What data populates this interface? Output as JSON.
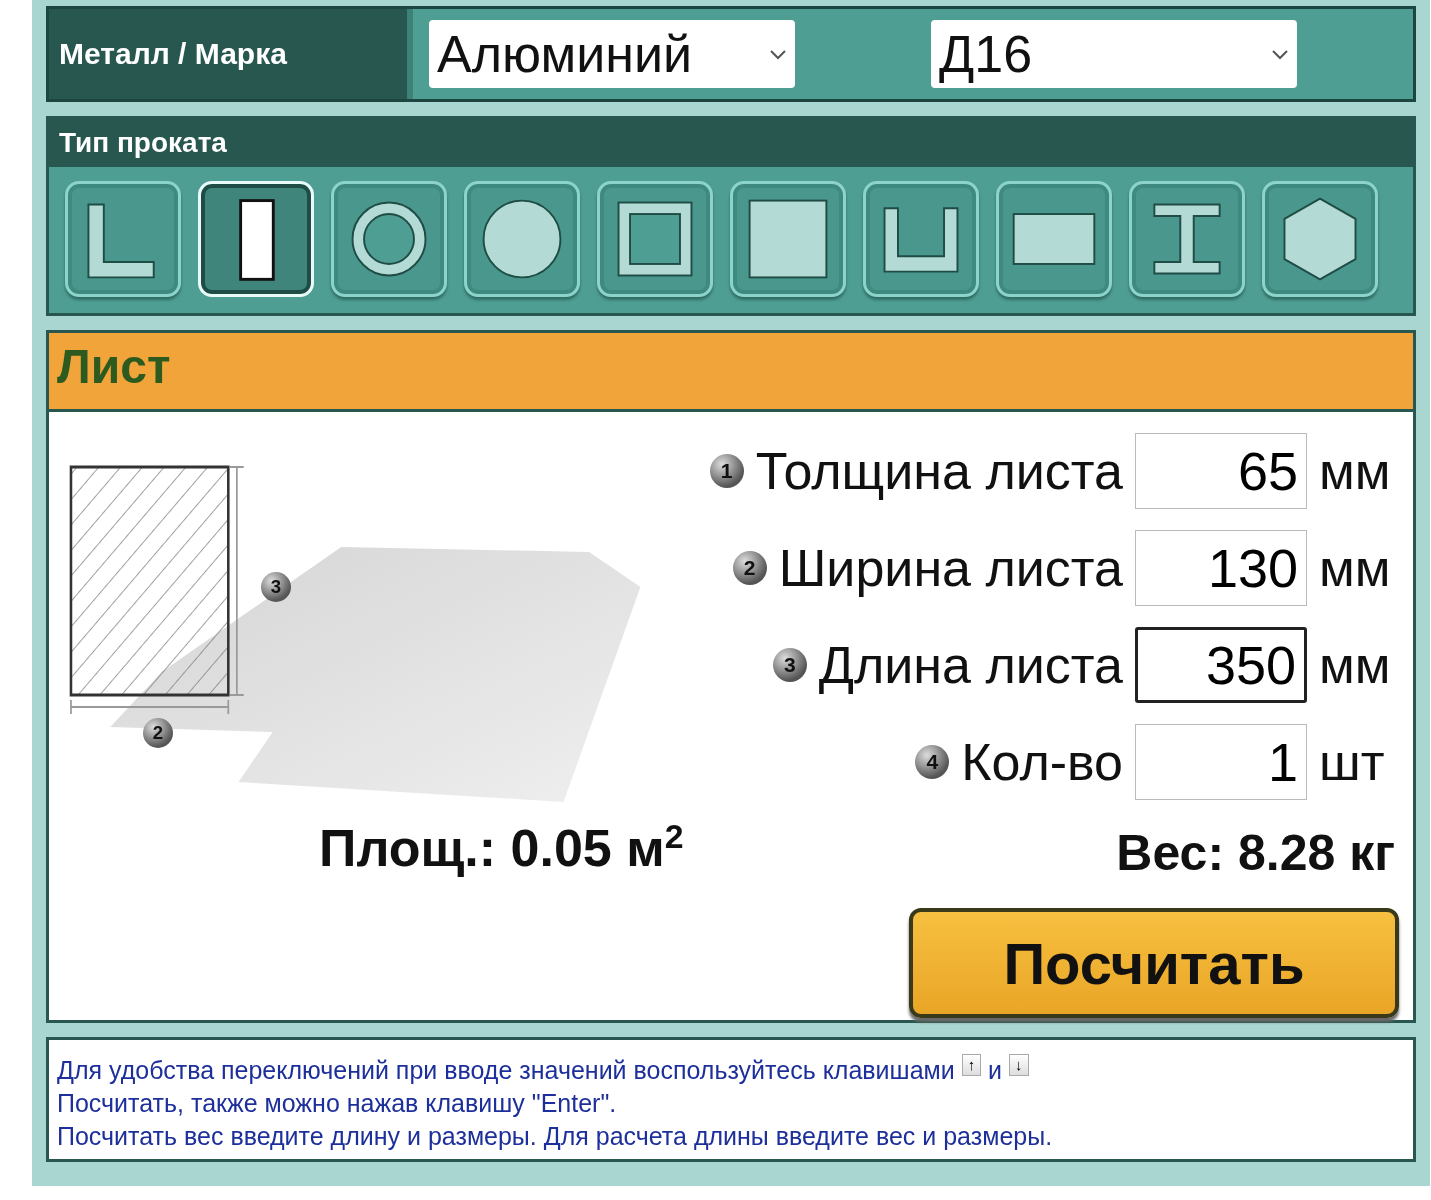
{
  "metal_bar": {
    "label": "Металл / Марка",
    "metal_select": {
      "value": "Алюминий"
    },
    "grade_select": {
      "value": "Д16"
    }
  },
  "profile_panel": {
    "title": "Тип проката",
    "profiles": [
      {
        "kind": "angle",
        "selected": false
      },
      {
        "kind": "sheet",
        "selected": true
      },
      {
        "kind": "pipe",
        "selected": false
      },
      {
        "kind": "round",
        "selected": false
      },
      {
        "kind": "square-tube",
        "selected": false
      },
      {
        "kind": "square",
        "selected": false
      },
      {
        "kind": "channel",
        "selected": false
      },
      {
        "kind": "strip",
        "selected": false
      },
      {
        "kind": "beam",
        "selected": false
      },
      {
        "kind": "hexagon",
        "selected": false
      }
    ]
  },
  "sheet_panel": {
    "title": "Лист",
    "drawing": {
      "height_marker": "3",
      "width_marker": "2"
    },
    "fields": [
      {
        "marker": "1",
        "label": "Толщина листа",
        "value": "65",
        "unit": "мм",
        "focused": false
      },
      {
        "marker": "2",
        "label": "Ширина листа",
        "value": "130",
        "unit": "мм",
        "focused": false
      },
      {
        "marker": "3",
        "label": "Длина листа",
        "value": "350",
        "unit": "мм",
        "focused": true
      },
      {
        "marker": "4",
        "label": "Кол-во",
        "value": "1",
        "unit": "шт",
        "focused": false
      }
    ],
    "area": "Площ.: 0.05 м$^{2}$",
    "weight": "Вес: 8.28 кг",
    "calculate_button": "Посчитать"
  },
  "info": {
    "line_1": "Для удобства переключений при вводе значений воспользуйтесь клавишами",
    "key_up": "↑",
    "conjunction": "и",
    "key_down": "↓",
    "line_2": "Посчитать, также можно нажав клавишу \"Enter\".",
    "line_3": "Посчитать вес введите длину и размеры. Для расчета длины введите вес и размеры."
  }
}
